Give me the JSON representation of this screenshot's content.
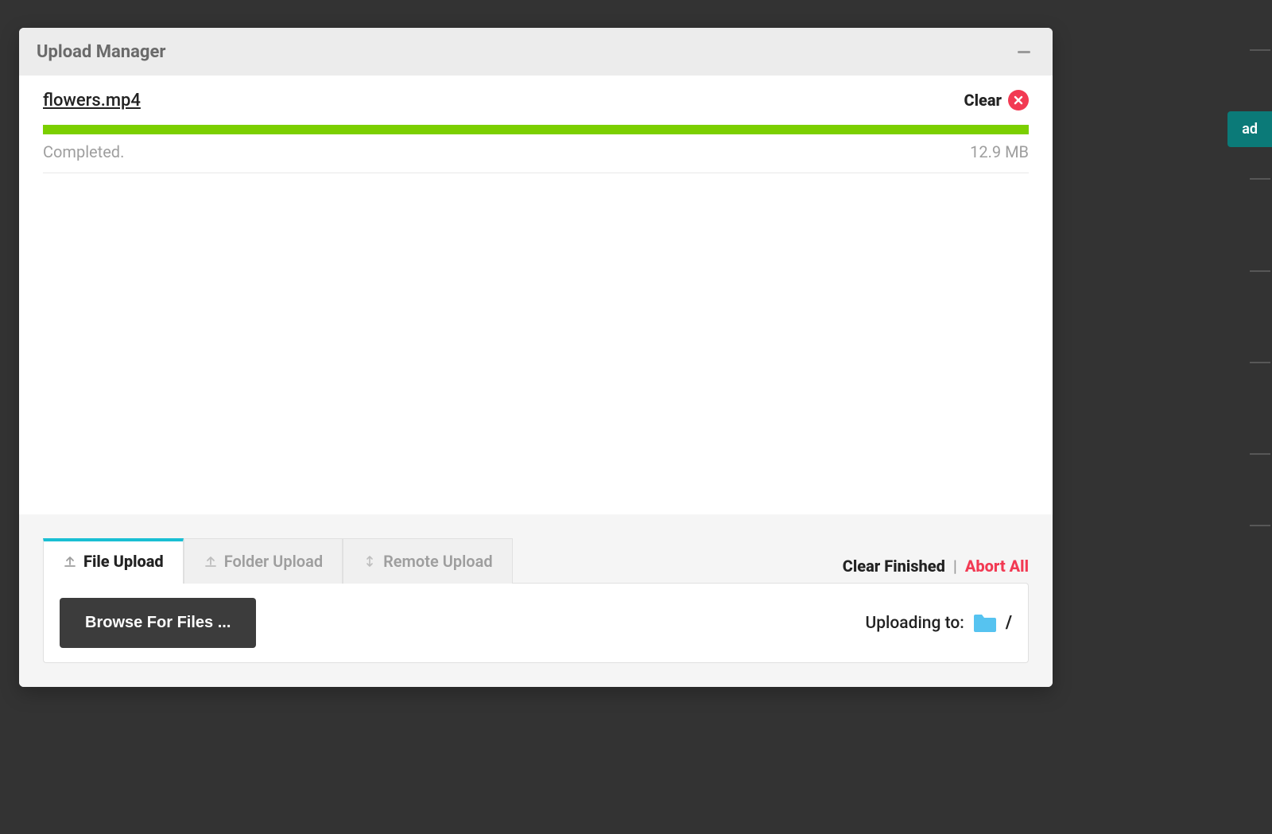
{
  "background": {
    "button_fragment": "ad"
  },
  "modal": {
    "title": "Upload Manager",
    "minimize_tooltip": "Minimize"
  },
  "upload": {
    "file_name": "flowers.mp4",
    "clear_label": "Clear",
    "status": "Completed.",
    "size": "12.9 MB",
    "progress_percent": 100,
    "progress_color": "#7bcf00"
  },
  "tabs": {
    "file_upload": "File Upload",
    "folder_upload": "Folder Upload",
    "remote_upload": "Remote Upload"
  },
  "footer_actions": {
    "clear_finished": "Clear Finished",
    "separator": "|",
    "abort_all": "Abort All"
  },
  "panel": {
    "browse_label": "Browse For Files ...",
    "uploading_to_label": "Uploading to:",
    "path": "/",
    "folder_color": "#56c3f0"
  }
}
